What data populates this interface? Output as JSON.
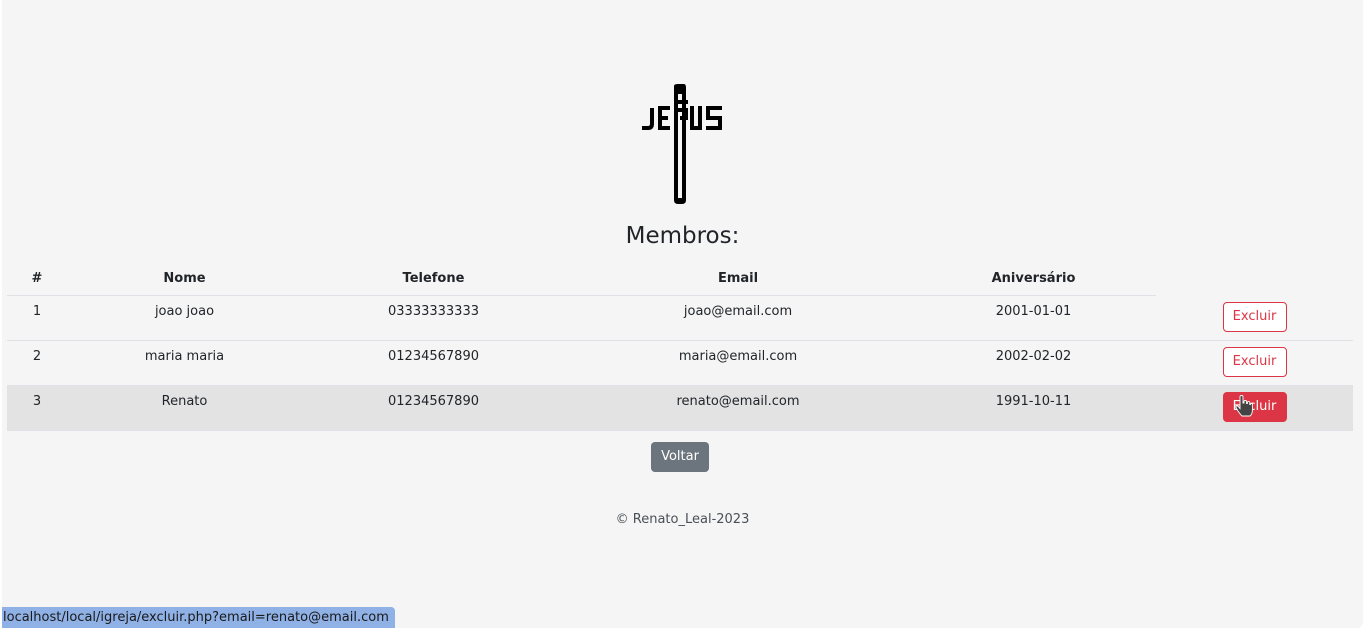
{
  "page": {
    "title": "Membros:",
    "logo_icon": "jesus-cross-logo"
  },
  "table": {
    "headers": {
      "index": "#",
      "name": "Nome",
      "phone": "Telefone",
      "email": "Email",
      "birthday": "Aniversário"
    },
    "rows": [
      {
        "index": "1",
        "name": "joao joao",
        "phone": "03333333333",
        "email": "joao@email.com",
        "birthday": "2001-01-01",
        "action": "Excluir"
      },
      {
        "index": "2",
        "name": "maria maria",
        "phone": "01234567890",
        "email": "maria@email.com",
        "birthday": "2002-02-02",
        "action": "Excluir"
      },
      {
        "index": "3",
        "name": "Renato",
        "phone": "01234567890",
        "email": "renato@email.com",
        "birthday": "1991-10-11",
        "action": "Excluir"
      }
    ]
  },
  "back_button": "Voltar",
  "footer": "© Renato_Leal-2023",
  "status_bar": "localhost/local/igreja/excluir.php?email=renato@email.com",
  "colors": {
    "danger": "#dc3545",
    "secondary": "#6c757d",
    "background": "#f5f5f5",
    "status_bar": "#8fb1e6"
  }
}
